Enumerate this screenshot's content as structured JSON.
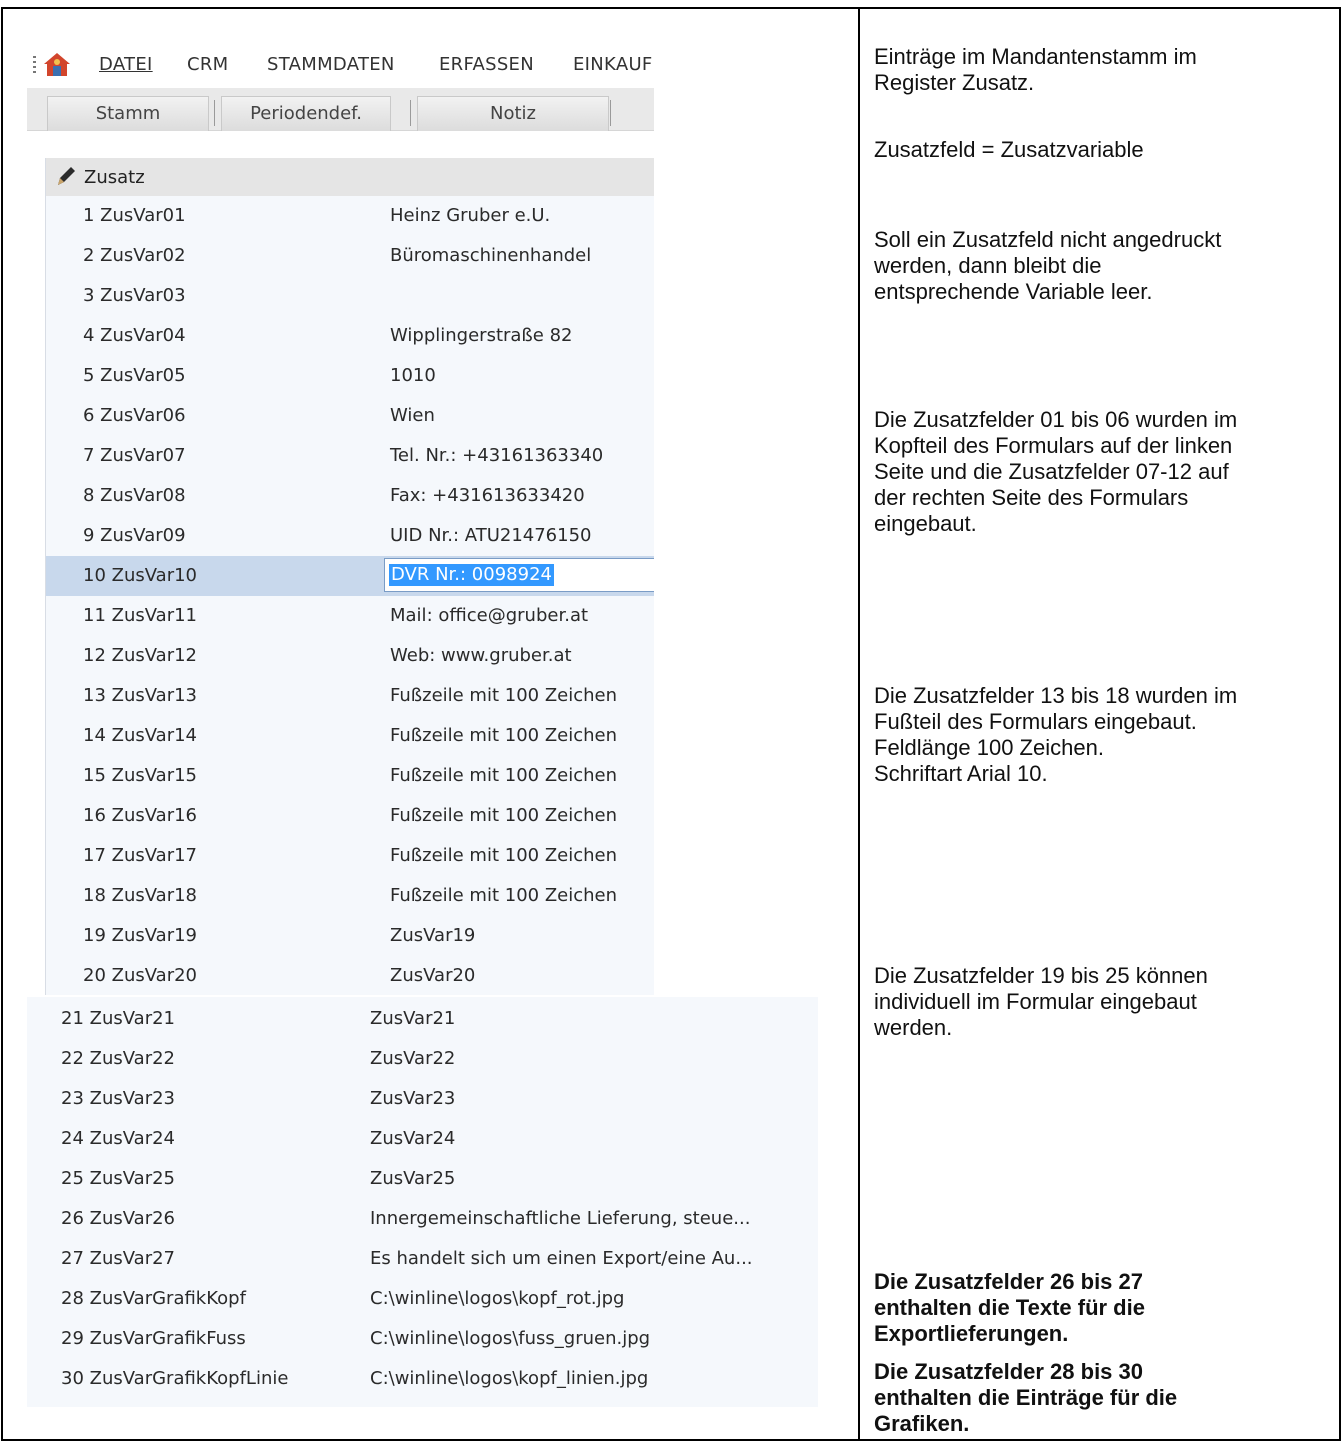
{
  "menu": {
    "items": [
      "DATEI",
      "CRM",
      "STAMMDATEN",
      "ERFASSEN",
      "EINKAUF"
    ]
  },
  "tabs": [
    "Stamm",
    "Periodendef.",
    "Notiz"
  ],
  "group": {
    "title": "Zusatz"
  },
  "rows_top": [
    {
      "key": "1 ZusVar01",
      "value": "Heinz Gruber e.U."
    },
    {
      "key": "2 ZusVar02",
      "value": "Büromaschinenhandel"
    },
    {
      "key": "3 ZusVar03",
      "value": ""
    },
    {
      "key": "4 ZusVar04",
      "value": "Wipplingerstraße 82"
    },
    {
      "key": "5 ZusVar05",
      "value": "1010"
    },
    {
      "key": "6 ZusVar06",
      "value": "Wien"
    },
    {
      "key": "7 ZusVar07",
      "value": "Tel. Nr.: +43161363340"
    },
    {
      "key": "8 ZusVar08",
      "value": "Fax: +431613633420"
    },
    {
      "key": "9 ZusVar09",
      "value": "UID Nr.: ATU21476150"
    },
    {
      "key": "10 ZusVar10",
      "value": "DVR Nr.: 0098924"
    },
    {
      "key": "11 ZusVar11",
      "value": "Mail: office@gruber.at"
    },
    {
      "key": "12 ZusVar12",
      "value": "Web: www.gruber.at"
    },
    {
      "key": "13 ZusVar13",
      "value": "Fußzeile mit 100 Zeichen"
    },
    {
      "key": "14 ZusVar14",
      "value": "Fußzeile mit 100 Zeichen"
    },
    {
      "key": "15 ZusVar15",
      "value": "Fußzeile mit 100 Zeichen"
    },
    {
      "key": "16 ZusVar16",
      "value": "Fußzeile mit 100 Zeichen"
    },
    {
      "key": "17 ZusVar17",
      "value": "Fußzeile mit 100 Zeichen"
    },
    {
      "key": "18 ZusVar18",
      "value": "Fußzeile mit 100 Zeichen"
    },
    {
      "key": "19 ZusVar19",
      "value": "ZusVar19"
    },
    {
      "key": "20 ZusVar20",
      "value": "ZusVar20"
    }
  ],
  "rows_bottom": [
    {
      "key": "21 ZusVar21",
      "value": "ZusVar21"
    },
    {
      "key": "22 ZusVar22",
      "value": "ZusVar22"
    },
    {
      "key": "23 ZusVar23",
      "value": "ZusVar23"
    },
    {
      "key": "24 ZusVar24",
      "value": "ZusVar24"
    },
    {
      "key": "25 ZusVar25",
      "value": "ZusVar25"
    },
    {
      "key": "26 ZusVar26",
      "value": "Innergemeinschaftliche Lieferung, steue..."
    },
    {
      "key": "27 ZusVar27",
      "value": "Es handelt sich um einen Export/eine Au..."
    },
    {
      "key": "28 ZusVarGrafikKopf",
      "value": "C:\\winline\\logos\\kopf_rot.jpg"
    },
    {
      "key": "29 ZusVarGrafikFuss",
      "value": "C:\\winline\\logos\\fuss_gruen.jpg"
    },
    {
      "key": "30 ZusVarGrafikKopfLinie",
      "value": "C:\\winline\\logos\\kopf_linien.jpg"
    }
  ],
  "selected_row_index": 9,
  "colors": {
    "selected_row": "#c8d8ec",
    "text_highlight": "#3399ff",
    "grid_background": "#f5f8fc"
  },
  "icons": [
    "app-logo-icon",
    "pencil-icon"
  ],
  "notes": [
    {
      "lines": [
        "Einträge im Mandantenstamm im",
        "Register Zusatz."
      ],
      "bold": false
    },
    {
      "lines": [
        "Zusatzfeld = Zusatzvariable"
      ],
      "bold": false
    },
    {
      "lines": [
        "Soll ein Zusatzfeld nicht angedruckt",
        "werden, dann bleibt die",
        "entsprechende Variable leer."
      ],
      "bold": false
    },
    {
      "lines": [
        "Die Zusatzfelder 01 bis 06 wurden im",
        "Kopfteil des Formulars auf der linken",
        "Seite und die Zusatzfelder 07-12 auf",
        "der rechten Seite des Formulars",
        "eingebaut."
      ],
      "bold": false
    },
    {
      "lines": [
        "Die Zusatzfelder 13 bis 18 wurden im",
        "Fußteil des Formulars eingebaut.",
        "Feldlänge 100 Zeichen.",
        "Schriftart Arial 10."
      ],
      "bold": false
    },
    {
      "lines": [
        "Die Zusatzfelder 19 bis 25 können",
        "individuell im Formular eingebaut",
        "werden."
      ],
      "bold": false
    },
    {
      "lines": [
        "Die Zusatzfelder 26 bis 27",
        "enthalten die Texte für die",
        "Exportlieferungen."
      ],
      "bold": true
    },
    {
      "lines": [
        "Die Zusatzfelder 28 bis 30",
        "enthalten die Einträge für die",
        "Grafiken."
      ],
      "bold": true
    }
  ]
}
